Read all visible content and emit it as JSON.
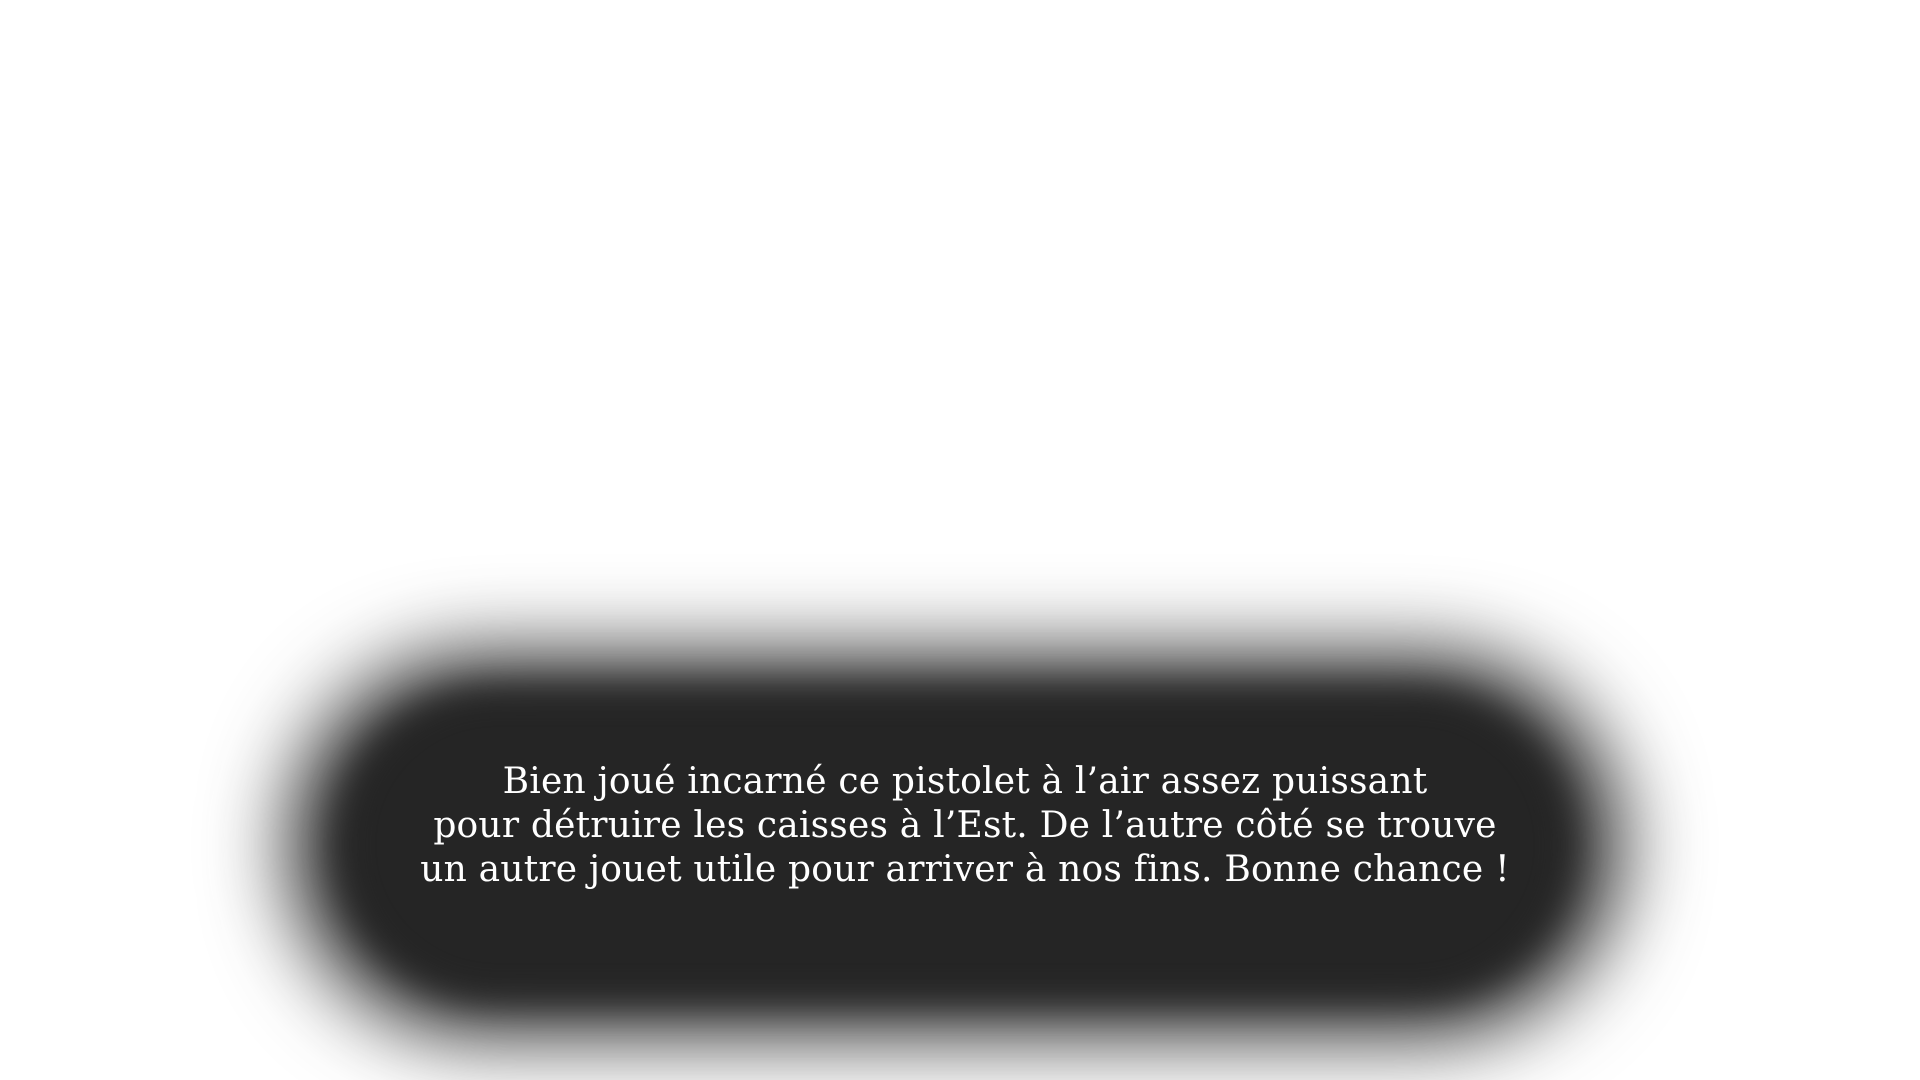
{
  "dialog": {
    "lines": [
      "Bien joué incarné ce pistolet à l’air assez puissant",
      "pour détruire les caisses à l’Est. De l’autre côté se trouve",
      "un autre jouet utile pour arriver à nos fins. Bonne chance !"
    ],
    "colors": {
      "background": "#ffffff",
      "panel": "#252525",
      "text": "#ffffff"
    }
  }
}
